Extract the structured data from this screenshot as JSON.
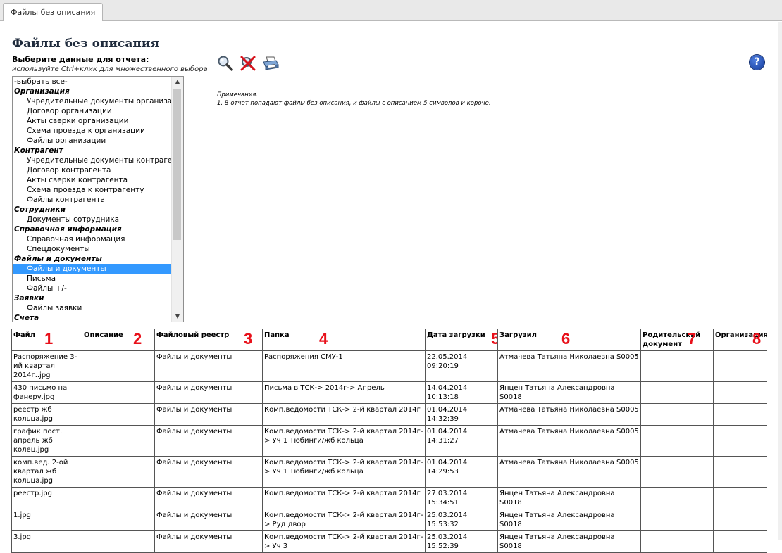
{
  "tab": {
    "label": "Файлы без описания"
  },
  "page": {
    "title": "Файлы без описания",
    "select_label": "Выберите данные для отчета:",
    "select_hint": "используйте Ctrl+клик для множественного выбора"
  },
  "listbox": {
    "items": [
      {
        "label": "-выбрать все-",
        "type": "all"
      },
      {
        "label": "Организация",
        "type": "group"
      },
      {
        "label": "Учредительные документы организации",
        "type": "option"
      },
      {
        "label": "Договор организации",
        "type": "option"
      },
      {
        "label": "Акты сверки организации",
        "type": "option"
      },
      {
        "label": "Схема проезда к организации",
        "type": "option"
      },
      {
        "label": "Файлы организации",
        "type": "option"
      },
      {
        "label": "Контрагент",
        "type": "group"
      },
      {
        "label": "Учредительные документы контрагента",
        "type": "option"
      },
      {
        "label": "Договор контрагента",
        "type": "option"
      },
      {
        "label": "Акты сверки контрагента",
        "type": "option"
      },
      {
        "label": "Схема проезда к контрагенту",
        "type": "option"
      },
      {
        "label": "Файлы контрагента",
        "type": "option"
      },
      {
        "label": "Сотрудники",
        "type": "group"
      },
      {
        "label": "Документы сотрудника",
        "type": "option"
      },
      {
        "label": "Справочная информация",
        "type": "group"
      },
      {
        "label": "Справочная информация",
        "type": "option"
      },
      {
        "label": "Спецдокументы",
        "type": "option"
      },
      {
        "label": "Файлы и документы",
        "type": "group"
      },
      {
        "label": "Файлы и документы",
        "type": "option",
        "selected": true
      },
      {
        "label": "Письма",
        "type": "option"
      },
      {
        "label": "Файлы +/-",
        "type": "option"
      },
      {
        "label": "Заявки",
        "type": "group"
      },
      {
        "label": "Файлы заявки",
        "type": "option"
      },
      {
        "label": "Счета",
        "type": "group"
      }
    ]
  },
  "toolbar": {
    "icons": [
      "search-icon",
      "clear-filter-icon",
      "print-icon"
    ],
    "help_label": "?"
  },
  "notes": {
    "title": "Примечания.",
    "line1": "1. В отчет попадают файлы без описания, и файлы с описанием 5 символов и короче."
  },
  "table": {
    "headers": [
      "Файл",
      "Описание",
      "Файловый реестр",
      "Папка",
      "Дата загрузки",
      "Загрузил",
      "Родительский документ",
      "Организация"
    ],
    "markers": [
      "1",
      "2",
      "3",
      "4",
      "5",
      "6",
      "7",
      "8"
    ],
    "rows": [
      [
        "Распоряжение 3-ий квартал 2014г..jpg",
        "",
        "Файлы и документы",
        "Распоряжения СМУ-1",
        "22.05.2014 09:20:19",
        "Атмачева Татьяна Николаевна S0005",
        "",
        ""
      ],
      [
        "430 письмо на фанеру.jpg",
        "",
        "Файлы и документы",
        "Письма в ТСК-> 2014г-> Апрель",
        "14.04.2014 10:13:18",
        "Янцен Татьяна Александровна S0018",
        "",
        ""
      ],
      [
        "реестр жб кольца.jpg",
        "",
        "Файлы и документы",
        "Комп.ведомости ТСК-> 2-й квартал 2014г",
        "01.04.2014 14:32:39",
        "Атмачева Татьяна Николаевна S0005",
        "",
        ""
      ],
      [
        "график пост. апрель жб колец.jpg",
        "",
        "Файлы и документы",
        "Комп.ведомости ТСК-> 2-й квартал 2014г-> Уч 1 Тюбинги/жб кольца",
        "01.04.2014 14:31:27",
        "Атмачева Татьяна Николаевна S0005",
        "",
        ""
      ],
      [
        "комп.вед. 2-ой квартал жб кольца.jpg",
        "",
        "Файлы и документы",
        "Комп.ведомости ТСК-> 2-й квартал 2014г-> Уч 1 Тюбинги/жб кольца",
        "01.04.2014 14:29:53",
        "Атмачева Татьяна Николаевна S0005",
        "",
        ""
      ],
      [
        "реестр.jpg",
        "",
        "Файлы и документы",
        "Комп.ведомости ТСК-> 2-й квартал 2014г",
        "27.03.2014 15:34:51",
        "Янцен Татьяна Александровна S0018",
        "",
        ""
      ],
      [
        "1.jpg",
        "",
        "Файлы и документы",
        "Комп.ведомости ТСК-> 2-й квартал 2014г-> Руд двор",
        "25.03.2014 15:53:32",
        "Янцен Татьяна Александровна S0018",
        "",
        ""
      ],
      [
        "3.jpg",
        "",
        "Файлы и документы",
        "Комп.ведомости ТСК-> 2-й квартал 2014г-> Уч 3",
        "25.03.2014 15:52:39",
        "Янцен Татьяна Александровна S0018",
        "",
        ""
      ]
    ]
  }
}
